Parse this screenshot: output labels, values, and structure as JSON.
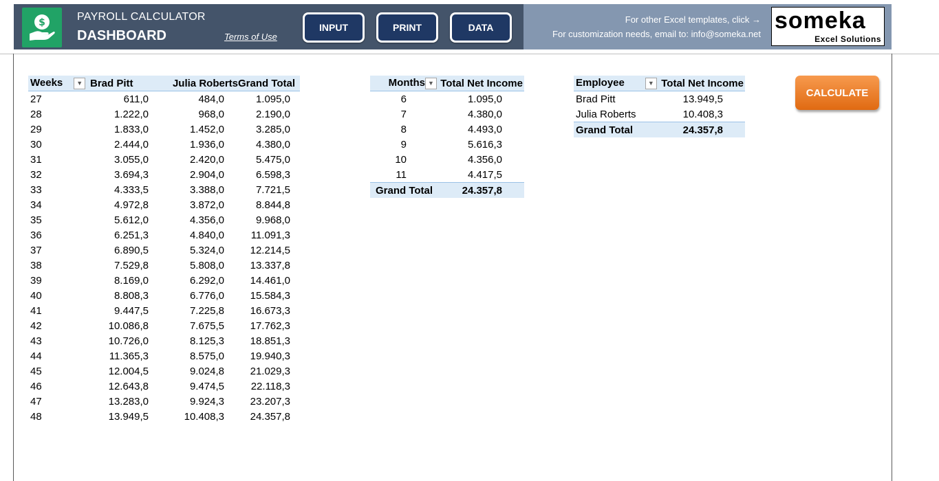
{
  "header": {
    "app_title": "PAYROLL CALCULATOR",
    "page_title": "DASHBOARD",
    "terms_link": "Terms of Use",
    "nav": {
      "input": "INPUT",
      "print": "PRINT",
      "data": "DATA"
    },
    "info_line1": "For other Excel templates, click →",
    "info_line2": "For customization needs, email to: info@someka.net",
    "brand_name": "someka",
    "brand_sub": "Excel Solutions",
    "logo_icon": "money-hand-icon"
  },
  "weeks_table": {
    "headers": [
      "Weeks",
      "Brad Pitt",
      "Julia Roberts",
      "Grand Total"
    ],
    "rows": [
      [
        "27",
        "611,0",
        "484,0",
        "1.095,0"
      ],
      [
        "28",
        "1.222,0",
        "968,0",
        "2.190,0"
      ],
      [
        "29",
        "1.833,0",
        "1.452,0",
        "3.285,0"
      ],
      [
        "30",
        "2.444,0",
        "1.936,0",
        "4.380,0"
      ],
      [
        "31",
        "3.055,0",
        "2.420,0",
        "5.475,0"
      ],
      [
        "32",
        "3.694,3",
        "2.904,0",
        "6.598,3"
      ],
      [
        "33",
        "4.333,5",
        "3.388,0",
        "7.721,5"
      ],
      [
        "34",
        "4.972,8",
        "3.872,0",
        "8.844,8"
      ],
      [
        "35",
        "5.612,0",
        "4.356,0",
        "9.968,0"
      ],
      [
        "36",
        "6.251,3",
        "4.840,0",
        "11.091,3"
      ],
      [
        "37",
        "6.890,5",
        "5.324,0",
        "12.214,5"
      ],
      [
        "38",
        "7.529,8",
        "5.808,0",
        "13.337,8"
      ],
      [
        "39",
        "8.169,0",
        "6.292,0",
        "14.461,0"
      ],
      [
        "40",
        "8.808,3",
        "6.776,0",
        "15.584,3"
      ],
      [
        "41",
        "9.447,5",
        "7.225,8",
        "16.673,3"
      ],
      [
        "42",
        "10.086,8",
        "7.675,5",
        "17.762,3"
      ],
      [
        "43",
        "10.726,0",
        "8.125,3",
        "18.851,3"
      ],
      [
        "44",
        "11.365,3",
        "8.575,0",
        "19.940,3"
      ],
      [
        "45",
        "12.004,5",
        "9.024,8",
        "21.029,3"
      ],
      [
        "46",
        "12.643,8",
        "9.474,5",
        "22.118,3"
      ],
      [
        "47",
        "13.283,0",
        "9.924,3",
        "23.207,3"
      ],
      [
        "48",
        "13.949,5",
        "10.408,3",
        "24.357,8"
      ]
    ]
  },
  "months_table": {
    "headers": [
      "Months",
      "Total Net Income"
    ],
    "rows": [
      [
        "6",
        "1.095,0"
      ],
      [
        "7",
        "4.380,0"
      ],
      [
        "8",
        "4.493,0"
      ],
      [
        "9",
        "5.616,3"
      ],
      [
        "10",
        "4.356,0"
      ],
      [
        "11",
        "4.417,5"
      ]
    ],
    "total_label": "Grand Total",
    "total_value": "24.357,8"
  },
  "employee_table": {
    "headers": [
      "Employee",
      "Total Net Income"
    ],
    "rows": [
      [
        "Brad Pitt",
        "13.949,5"
      ],
      [
        "Julia Roberts",
        "10.408,3"
      ]
    ],
    "total_label": "Grand Total",
    "total_value": "24.357,8"
  },
  "calculate_button": "CALCULATE",
  "colors": {
    "header_bg": "#44546a",
    "header_right_bg": "#8497b0",
    "nav_button": "#1f3864",
    "pivot_header": "#ddebf7",
    "calculate": "#ed7d31",
    "logo_green": "#21a366"
  }
}
